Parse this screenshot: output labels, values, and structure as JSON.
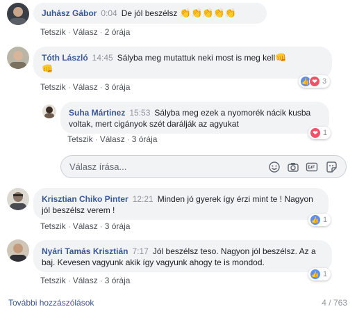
{
  "comments": [
    {
      "name": "Juhász Gábor",
      "time": "0:04",
      "text": "De jól beszélsz",
      "emoji": "👏👏👏👏👏",
      "like": "Tetszik",
      "reply": "Válasz",
      "age": "2 órája"
    },
    {
      "name": "Tóth László",
      "time": "14:45",
      "text": "Sályba meg mutattuk neki most is meg kell",
      "emoji_a": "👊",
      "emoji_b": "👊",
      "like": "Tetszik",
      "reply": "Válasz",
      "age": "3 órája",
      "reaction_count": "3"
    },
    {
      "name": "Suha Mártinez",
      "time": "15:53",
      "text": "Sályba meg ezek a nyomorék nácik kusba voltak, mert cigányok szét darálják az agyukat",
      "like": "Tetszik",
      "reply": "Válasz",
      "age": "3 órája",
      "reaction_count": "1"
    },
    {
      "name": "Krisztian Chiko Pinter",
      "time": "12:21",
      "text": "Minden jó gyerek így érzi mint te ! Nagyon jól beszélsz verem !",
      "like": "Tetszik",
      "reply": "Válasz",
      "age": "3 órája",
      "reaction_count": "1"
    },
    {
      "name": "Nyári Tamás Krisztián",
      "time": "7:17",
      "text": "Jól beszélsz teso. Nagyon jól beszélsz. Az a baj. Kevesen vagyunk akik így vagyunk ahogy te is mondod.",
      "like": "Tetszik",
      "reply": "Válasz",
      "age": "3 órája",
      "reaction_count": "1"
    }
  ],
  "reply_box": {
    "placeholder": "Válasz írása..."
  },
  "footer": {
    "more": "További hozzászólások",
    "count": "4 / 763"
  },
  "separator": "·",
  "icons": {
    "like": "like-icon",
    "love": "love-icon",
    "emoji": "smiley-icon",
    "camera": "camera-icon",
    "gif": "gif-icon",
    "sticker": "sticker-icon"
  },
  "colors": {
    "name": "#385898",
    "bubble": "#f2f3f5",
    "like": "#5890ff",
    "love": "#f25268"
  }
}
